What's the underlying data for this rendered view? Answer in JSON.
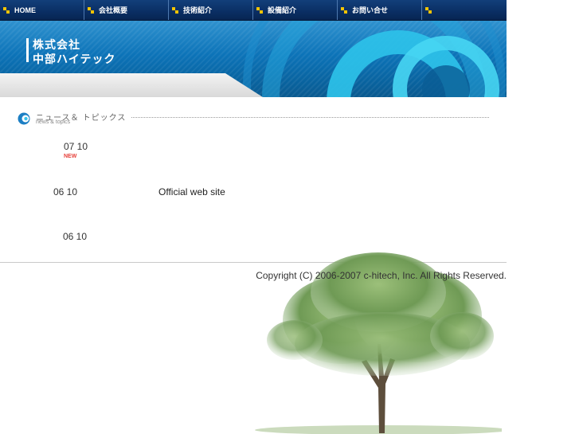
{
  "nav": {
    "items": [
      {
        "label": "HOME"
      },
      {
        "label": "会社概要"
      },
      {
        "label": "技術紹介"
      },
      {
        "label": "設備紹介"
      },
      {
        "label": "お問い合せ"
      },
      {
        "label": ""
      }
    ]
  },
  "header": {
    "logo_line1": "株式会社",
    "logo_line2": "中部ハイテック"
  },
  "news": {
    "title_jp": "ニュース＆ トピックス",
    "title_en": "news & topics",
    "items": [
      {
        "date": "07 10",
        "badge": "NEW",
        "text": ""
      },
      {
        "date": "06 10",
        "badge": "",
        "text": "Official web site"
      },
      {
        "date": "06 10",
        "badge": "",
        "text": ""
      }
    ]
  },
  "footer": {
    "copyright": "Copyright (C) 2006-2007 c-hitech, Inc. All Rights Reserved."
  },
  "colors": {
    "nav_bg": "#0a2e63",
    "nav_arrow": "#f2c300",
    "banner_blue": "#0c73b8",
    "new_badge": "#e6403a"
  }
}
